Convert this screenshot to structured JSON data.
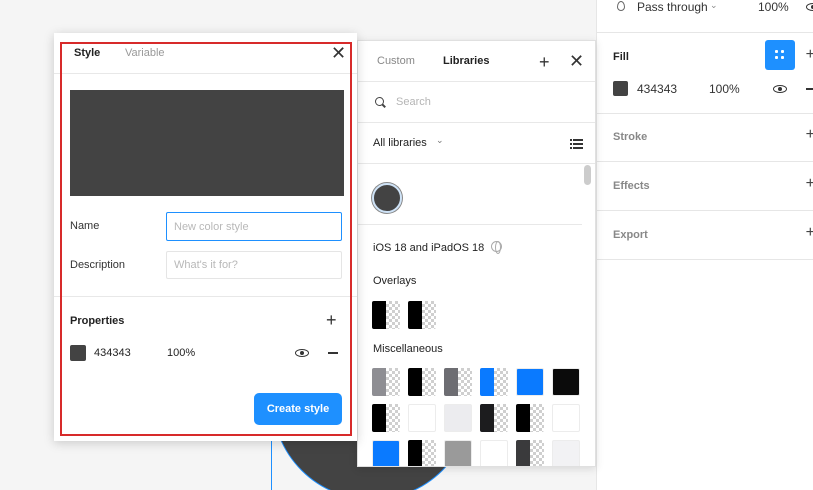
{
  "canvas": {},
  "properties_panel": {
    "layer": {
      "blend_mode": "Pass through",
      "opacity": "100%"
    },
    "fill": {
      "title": "Fill",
      "hex": "434343",
      "opacity": "100%"
    },
    "sections": [
      {
        "title": "Stroke"
      },
      {
        "title": "Effects"
      },
      {
        "title": "Export"
      }
    ]
  },
  "libraries_panel": {
    "tabs": [
      "Custom",
      "Libraries"
    ],
    "active_tab": "Libraries",
    "search_placeholder": "Search",
    "filter": "All libraries",
    "library_name": "iOS 18 and iPadOS 18",
    "groups": [
      {
        "title": "Overlays"
      },
      {
        "title": "Miscellaneous"
      }
    ],
    "colors": {
      "document_color": "#434343",
      "overlays": [
        "#000000",
        "#000000"
      ],
      "misc_row1": [
        "#8e8e93",
        "#000000",
        "#6d6d72",
        "#0a7aff",
        "#0a7aff",
        "#0b0b0b"
      ],
      "misc_row2": [
        "#000000",
        "#ffffff",
        "#ececef",
        "#1c1c1e",
        "#000000",
        "#ffffff"
      ],
      "misc_row3": [
        "#0a7aff",
        "#000000",
        "#9a9a9a",
        "#ffffff",
        "#3a3a3c",
        "#f2f2f4"
      ]
    }
  },
  "style_dialog": {
    "tabs": {
      "active": "Style",
      "inactive": "Variable"
    },
    "preview_color": "#434343",
    "name_label": "Name",
    "name_placeholder": "New color style",
    "description_label": "Description",
    "description_placeholder": "What's it for?",
    "properties_title": "Properties",
    "property": {
      "hex": "434343",
      "opacity": "100%"
    },
    "create_button": "Create style"
  },
  "accent_color": "#1e90ff",
  "highlight_color": "#d72a2a"
}
